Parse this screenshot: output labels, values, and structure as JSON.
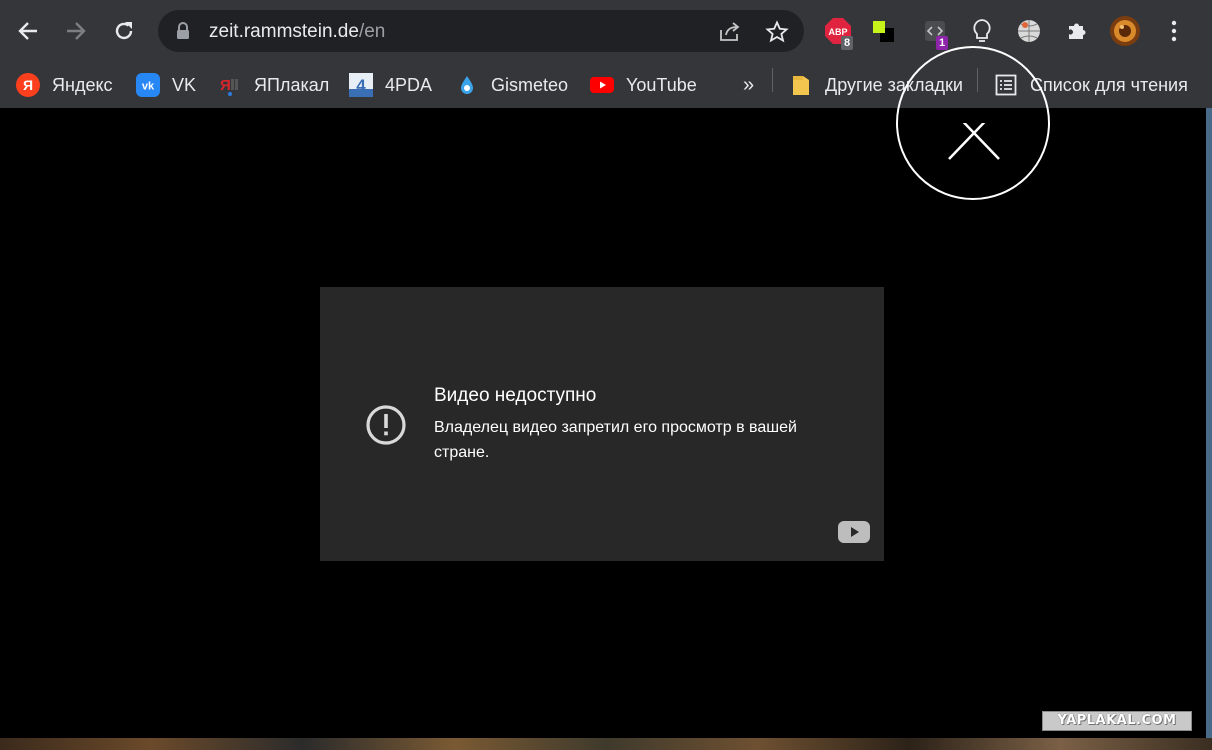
{
  "toolbar": {
    "url_host": "zeit.rammstein.de",
    "url_path": "/en",
    "extensions": {
      "abp_label": "ABP",
      "abp_badge": "8",
      "devtools_badge": "1"
    }
  },
  "bookmarks": {
    "items": [
      {
        "label": "Яндекс",
        "icon": "yandex-icon"
      },
      {
        "label": "VK",
        "icon": "vk-icon"
      },
      {
        "label": "ЯПлакал",
        "icon": "yaplakal-icon"
      },
      {
        "label": "4PDA",
        "icon": "4pda-icon"
      },
      {
        "label": "Gismeteo",
        "icon": "gismeteo-icon"
      },
      {
        "label": "YouTube",
        "icon": "youtube-icon"
      }
    ],
    "overflow_label": "»",
    "other_bookmarks_label": "Другие закладки",
    "reading_list_label": "Список для чтения"
  },
  "video": {
    "title": "Видео недоступно",
    "message": "Владелец видео запретил его просмотр в вашей стране."
  },
  "watermark": "YAPLAKAL.COM",
  "colors": {
    "toolbar_bg": "#35363a",
    "omnibox_bg": "#202124",
    "video_box_bg": "#282828",
    "page_bg": "#000000"
  }
}
